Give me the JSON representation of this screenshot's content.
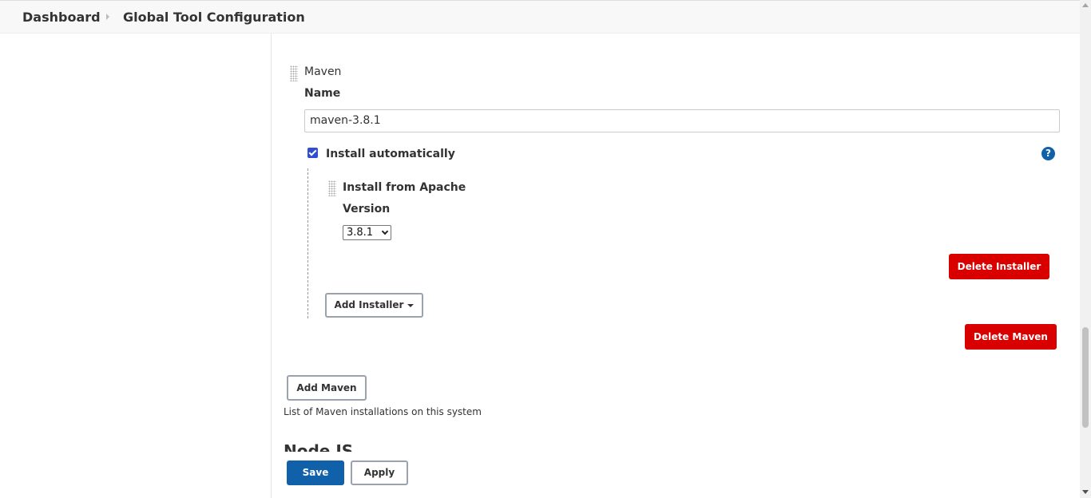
{
  "breadcrumb": {
    "items": [
      "Dashboard",
      "Global Tool Configuration"
    ]
  },
  "maven": {
    "section_label": "Maven",
    "name_label": "Name",
    "name_value": "maven-3.8.1",
    "install_auto_label": "Install automatically",
    "install_auto_checked": true,
    "help_icon": "?",
    "installer": {
      "title": "Install from Apache",
      "version_label": "Version",
      "version_selected": "3.8.1",
      "delete_installer_label": "Delete Installer"
    },
    "add_installer_label": "Add Installer",
    "delete_maven_label": "Delete Maven",
    "add_maven_label": "Add Maven",
    "description": "List of Maven installations on this system"
  },
  "next_section": {
    "title": "Node JS"
  },
  "footer": {
    "save_label": "Save",
    "apply_label": "Apply"
  },
  "colors": {
    "danger": "#d90000",
    "primary": "#1160aa",
    "checkbox": "#2f4fd3"
  }
}
